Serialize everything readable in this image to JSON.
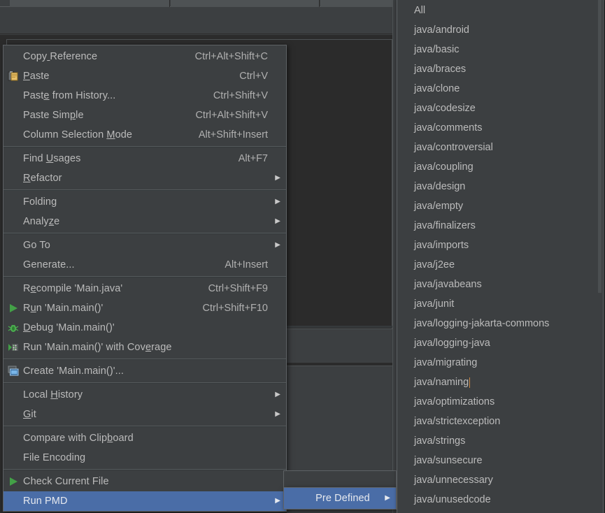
{
  "app": {
    "theme_bg": "#3c3f41",
    "editor_bg": "#2b2b2b",
    "highlight_color": "#4a6da7",
    "text_color": "#bbbbbb"
  },
  "context_menu": {
    "name": "editor-context-menu",
    "groups": [
      {
        "items": [
          {
            "label": "Copy Reference",
            "shortcut": "Ctrl+Alt+Shift+C",
            "icon": "",
            "submenu": false,
            "selected": false
          },
          {
            "label": "Paste",
            "shortcut": "Ctrl+V",
            "icon": "paste-icon",
            "submenu": false,
            "selected": false
          },
          {
            "label": "Paste from History...",
            "shortcut": "Ctrl+Shift+V",
            "icon": "",
            "submenu": false,
            "selected": false
          },
          {
            "label": "Paste Simple",
            "shortcut": "Ctrl+Alt+Shift+V",
            "icon": "",
            "submenu": false,
            "selected": false
          },
          {
            "label": "Column Selection Mode",
            "shortcut": "Alt+Shift+Insert",
            "icon": "",
            "submenu": false,
            "selected": false
          }
        ]
      },
      {
        "items": [
          {
            "label": "Find Usages",
            "shortcut": "Alt+F7",
            "icon": "",
            "submenu": false,
            "selected": false
          },
          {
            "label": "Refactor",
            "shortcut": "",
            "icon": "",
            "submenu": true,
            "selected": false
          }
        ]
      },
      {
        "items": [
          {
            "label": "Folding",
            "shortcut": "",
            "icon": "",
            "submenu": true,
            "selected": false
          },
          {
            "label": "Analyze",
            "shortcut": "",
            "icon": "",
            "submenu": true,
            "selected": false
          }
        ]
      },
      {
        "items": [
          {
            "label": "Go To",
            "shortcut": "",
            "icon": "",
            "submenu": true,
            "selected": false
          },
          {
            "label": "Generate...",
            "shortcut": "Alt+Insert",
            "icon": "",
            "submenu": false,
            "selected": false
          }
        ]
      },
      {
        "items": [
          {
            "label": "Recompile 'Main.java'",
            "shortcut": "Ctrl+Shift+F9",
            "icon": "",
            "submenu": false,
            "selected": false
          },
          {
            "label": "Run 'Main.main()'",
            "shortcut": "Ctrl+Shift+F10",
            "icon": "run-icon",
            "submenu": false,
            "selected": false
          },
          {
            "label": "Debug 'Main.main()'",
            "shortcut": "",
            "icon": "debug-icon",
            "submenu": false,
            "selected": false
          },
          {
            "label": "Run 'Main.main()' with Coverage",
            "shortcut": "",
            "icon": "coverage-icon",
            "submenu": false,
            "selected": false
          }
        ]
      },
      {
        "items": [
          {
            "label": "Create 'Main.main()'...",
            "shortcut": "",
            "icon": "create-config-icon",
            "submenu": false,
            "selected": false
          }
        ]
      },
      {
        "items": [
          {
            "label": "Local History",
            "shortcut": "",
            "icon": "",
            "submenu": true,
            "selected": false
          },
          {
            "label": "Git",
            "shortcut": "",
            "icon": "",
            "submenu": true,
            "selected": false
          }
        ]
      },
      {
        "items": [
          {
            "label": "Compare with Clipboard",
            "shortcut": "",
            "icon": "",
            "submenu": false,
            "selected": false
          },
          {
            "label": "File Encoding",
            "shortcut": "",
            "icon": "",
            "submenu": false,
            "selected": false
          }
        ]
      },
      {
        "items": [
          {
            "label": "Check Current File",
            "shortcut": "",
            "icon": "run-icon",
            "submenu": false,
            "selected": false
          },
          {
            "label": "Run PMD",
            "shortcut": "",
            "icon": "",
            "submenu": true,
            "selected": true
          }
        ]
      }
    ]
  },
  "pre_defined_menu": {
    "name": "run-pmd-submenu",
    "items": [
      {
        "label": "Pre Defined",
        "submenu": true,
        "selected": true
      }
    ]
  },
  "rulesets_menu": {
    "name": "pre-defined-rulesets-submenu",
    "items": [
      {
        "label": "All"
      },
      {
        "label": "java/android"
      },
      {
        "label": "java/basic"
      },
      {
        "label": "java/braces"
      },
      {
        "label": "java/clone"
      },
      {
        "label": "java/codesize"
      },
      {
        "label": "java/comments"
      },
      {
        "label": "java/controversial"
      },
      {
        "label": "java/coupling"
      },
      {
        "label": "java/design"
      },
      {
        "label": "java/empty"
      },
      {
        "label": "java/finalizers"
      },
      {
        "label": "java/imports"
      },
      {
        "label": "java/j2ee"
      },
      {
        "label": "java/javabeans"
      },
      {
        "label": "java/junit"
      },
      {
        "label": "java/logging-jakarta-commons"
      },
      {
        "label": "java/logging-java"
      },
      {
        "label": "java/migrating"
      },
      {
        "label": "java/naming"
      },
      {
        "label": "java/optimizations"
      },
      {
        "label": "java/strictexception"
      },
      {
        "label": "java/strings"
      },
      {
        "label": "java/sunsecure"
      },
      {
        "label": "java/unnecessary"
      },
      {
        "label": "java/unusedcode"
      }
    ]
  }
}
